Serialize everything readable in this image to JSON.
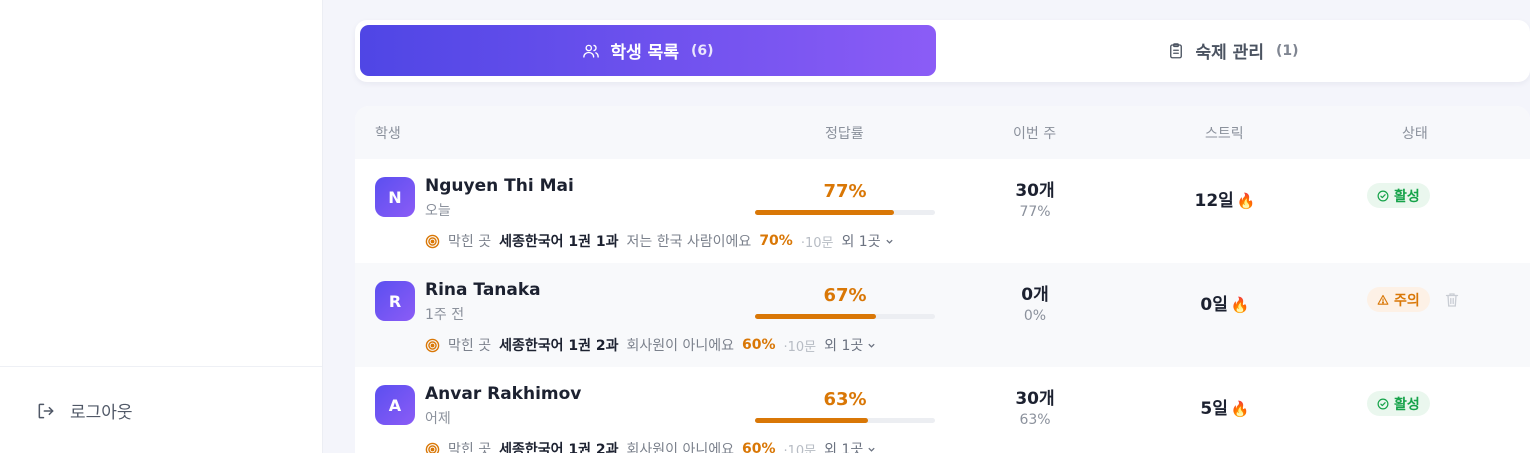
{
  "sidebar": {
    "logout_label": "로그아웃"
  },
  "tabs": [
    {
      "label": "학생 목록",
      "count": "(6)",
      "icon": "users-icon",
      "active": true
    },
    {
      "label": "숙제 관리",
      "count": "(1)",
      "icon": "clipboard-icon",
      "active": false
    }
  ],
  "table": {
    "headers": {
      "student": "학생",
      "accuracy": "정답률",
      "this_week": "이번 주",
      "streak": "스트릭",
      "status": "상태"
    },
    "rows": [
      {
        "initial": "N",
        "name": "Nguyen Thi Mai",
        "last_seen": "오늘",
        "accuracy_label": "77%",
        "accuracy": 0.77,
        "week_count": "30개",
        "week_pct": "77%",
        "streak": "12일",
        "status": "활성",
        "status_type": "active",
        "stuck_label": "막힌 곳",
        "stuck_lesson": "세종한국어 1권 1과",
        "stuck_topic": "저는 한국 사람이에요",
        "stuck_pct": "70%",
        "stuck_q": "·10문",
        "stuck_more": "외 1곳"
      },
      {
        "initial": "R",
        "name": "Rina Tanaka",
        "last_seen": "1주 전",
        "accuracy_label": "67%",
        "accuracy": 0.67,
        "week_count": "0개",
        "week_pct": "0%",
        "streak": "0일",
        "status": "주의",
        "status_type": "warn",
        "stuck_label": "막힌 곳",
        "stuck_lesson": "세종한국어 1권 2과",
        "stuck_topic": "회사원이 아니에요",
        "stuck_pct": "60%",
        "stuck_q": "·10문",
        "stuck_more": "외 1곳"
      },
      {
        "initial": "A",
        "name": "Anvar Rakhimov",
        "last_seen": "어제",
        "accuracy_label": "63%",
        "accuracy": 0.63,
        "week_count": "30개",
        "week_pct": "63%",
        "streak": "5일",
        "status": "활성",
        "status_type": "active",
        "stuck_label": "막힌 곳",
        "stuck_lesson": "세종한국어 1권 2과",
        "stuck_topic": "회사원이 아니에요",
        "stuck_pct": "60%",
        "stuck_q": "·10문",
        "stuck_more": "외 1곳"
      }
    ]
  },
  "colors": {
    "accent_start": "#4f46e5",
    "accent_end": "#8b5cf6",
    "warning": "#d97706",
    "success": "#16a34a"
  }
}
